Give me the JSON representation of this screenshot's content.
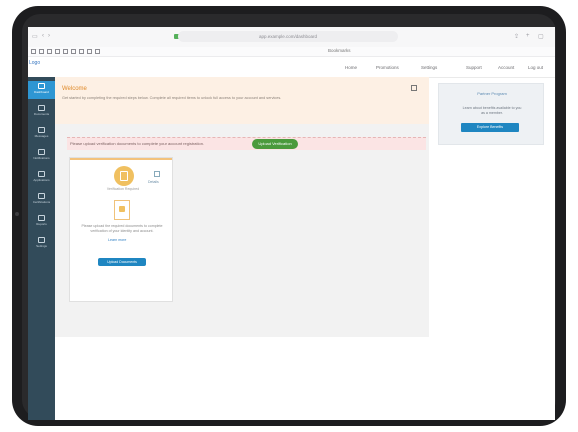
{
  "browser": {
    "url": "app.example.com/dashboard",
    "bookmarks_label": "Bookmarks"
  },
  "topnav": {
    "brand": "Logo",
    "items": [
      "Home",
      "Promotions",
      "Settings",
      "Support",
      "Account",
      "Log out"
    ]
  },
  "rail": {
    "items": [
      {
        "label": "Dashboard",
        "icon": "dashboard-icon",
        "active": true
      },
      {
        "label": "Documents",
        "icon": "documents-icon",
        "active": false
      },
      {
        "label": "Messages",
        "icon": "messages-icon",
        "active": false
      },
      {
        "label": "Notifications",
        "icon": "notifications-icon",
        "active": false
      },
      {
        "label": "Applications",
        "icon": "applications-icon",
        "active": false
      },
      {
        "label": "Certifications",
        "icon": "certifications-icon",
        "active": false
      },
      {
        "label": "Reports",
        "icon": "reports-icon",
        "active": false
      },
      {
        "label": "Settings",
        "icon": "settings-icon",
        "active": false
      }
    ]
  },
  "banner": {
    "title": "Welcome",
    "text": "Get started by completing the required steps below. Complete all required items to unlock full access to your account and services."
  },
  "alert": {
    "text": "Please upload verification documents to complete your account registration.",
    "button": "Upload Verification"
  },
  "card": {
    "badge_label": "Verification Required",
    "side_label": "Details",
    "description": "Please upload the required documents to complete verification of your identity and account.",
    "link": "Learn more",
    "button": "Upload Documents"
  },
  "promo": {
    "logo": "Partner Program",
    "text": "Learn about benefits available to you as a member.",
    "button": "Explore Benefits"
  },
  "colors": {
    "rail_bg": "#324b5a",
    "rail_active": "#2e96d3",
    "banner_bg": "#fdf0e4",
    "alert_bg": "#fbe4e4",
    "success": "#4b9a3b",
    "primary": "#1f86c1",
    "badge": "#f0c060"
  }
}
